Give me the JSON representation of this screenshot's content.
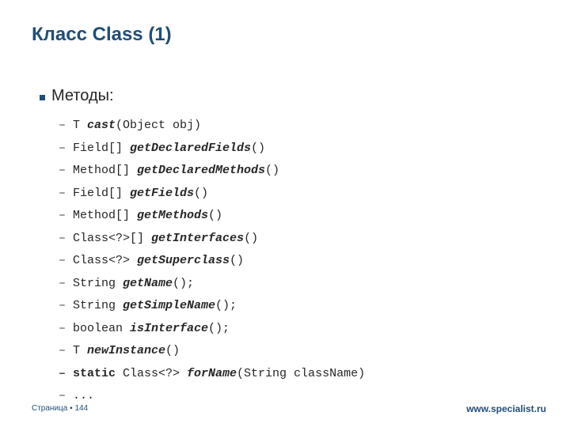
{
  "title": "Класс Class (1)",
  "section_label": "Методы:",
  "dash": "–",
  "methods": [
    {
      "ret": "T ",
      "name": "cast",
      "args": "(Object obj)",
      "static": false
    },
    {
      "ret": "Field[] ",
      "name": "getDeclaredFields",
      "args": "()",
      "static": false
    },
    {
      "ret": "Method[] ",
      "name": "getDeclaredMethods",
      "args": "()",
      "static": false
    },
    {
      "ret": "Field[] ",
      "name": "getFields",
      "args": "()",
      "static": false
    },
    {
      "ret": "Method[] ",
      "name": "getMethods",
      "args": "()",
      "static": false
    },
    {
      "ret": "Class<?>[] ",
      "name": "getInterfaces",
      "args": "()",
      "static": false
    },
    {
      "ret": "Class<?> ",
      "name": "getSuperclass",
      "args": "()",
      "static": false
    },
    {
      "ret": "String ",
      "name": "getName",
      "args": "();",
      "static": false
    },
    {
      "ret": "String ",
      "name": "getSimpleName",
      "args": "();",
      "static": false
    },
    {
      "ret": "boolean ",
      "name": "isInterface",
      "args": "();",
      "static": false
    },
    {
      "ret": "T ",
      "name": "newInstance",
      "args": "()",
      "static": false
    },
    {
      "ret": " Class<?> ",
      "name": "forName",
      "args": "(String className)",
      "static": true
    }
  ],
  "ellipsis": "...",
  "footer": {
    "left_prefix": "Страница ▪ ",
    "page": "144",
    "right": "www.specialist.ru"
  }
}
